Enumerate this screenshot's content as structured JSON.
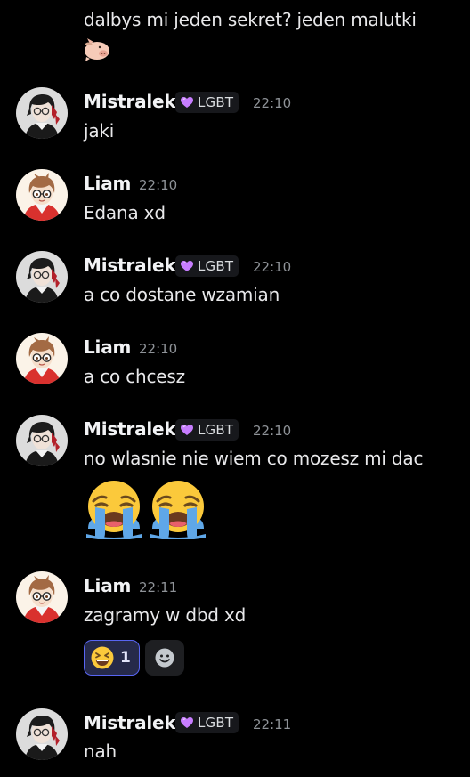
{
  "messages": [
    {
      "text": "dalbys mi jeden sekret? jeden malutki",
      "sticker": "pig-sticker-icon"
    },
    {
      "author": "Mistralek",
      "tag": "LGBT",
      "time": "22:10",
      "text": "jaki"
    },
    {
      "author": "Liam",
      "time": "22:10",
      "text": "Edana xd"
    },
    {
      "author": "Mistralek",
      "tag": "LGBT",
      "time": "22:10",
      "text": "a co dostane wzamian"
    },
    {
      "author": "Liam",
      "time": "22:10",
      "text": "a co chcesz"
    },
    {
      "author": "Mistralek",
      "tag": "LGBT",
      "time": "22:10",
      "text": "no wlasnie nie wiem co mozesz mi dac",
      "emojis": [
        "loudly-crying-face-icon",
        "loudly-crying-face-icon"
      ]
    },
    {
      "author": "Liam",
      "time": "22:11",
      "text": "zagramy w dbd xd",
      "reactions": [
        {
          "emoji": "laughing-face-icon",
          "count": "1"
        }
      ],
      "add_reaction_icon": "add-reaction-icon"
    },
    {
      "author": "Mistralek",
      "tag": "LGBT",
      "time": "22:11",
      "text": "nah"
    }
  ],
  "colors": {
    "background": "#000000",
    "tag_heart": "#c77dff",
    "reaction_border": "#5865f2"
  }
}
